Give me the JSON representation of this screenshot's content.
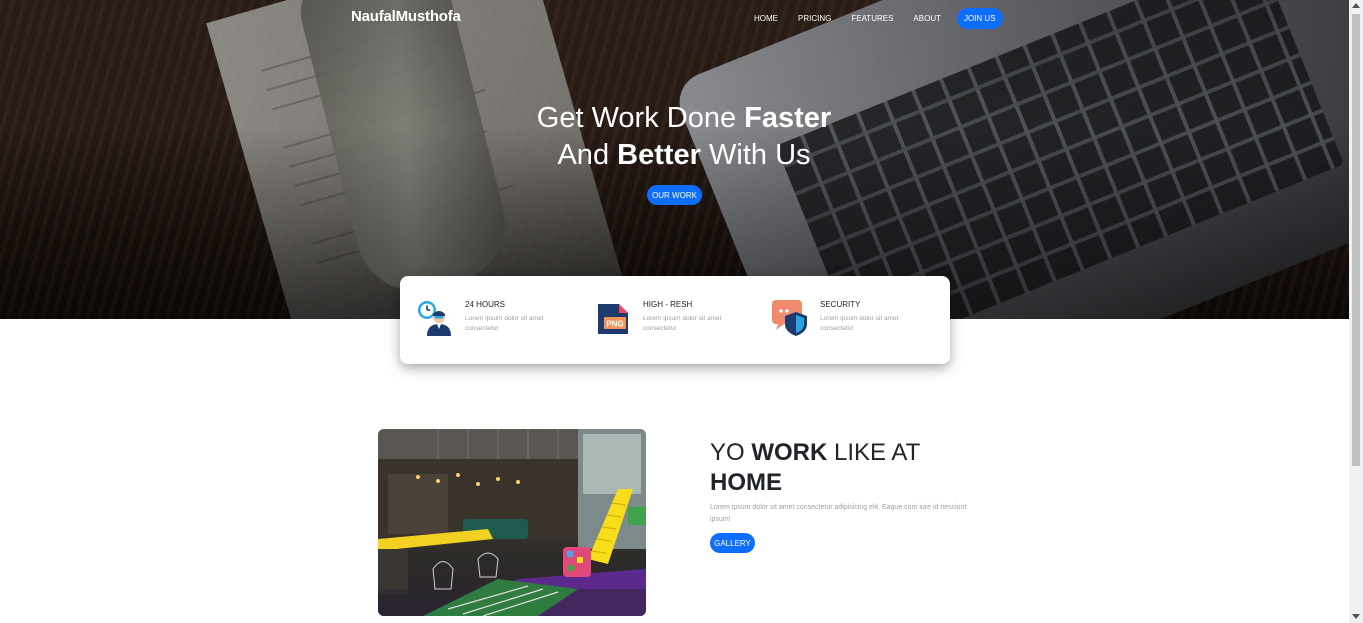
{
  "navbar": {
    "brand": "NaufalMusthofa",
    "links": [
      "HOME",
      "PRICING",
      "FEATURES",
      "ABOUT"
    ],
    "cta": "JOIN US"
  },
  "hero": {
    "line1_normal": "Get Work Done ",
    "line1_bold": "Faster",
    "line2_normal_a": "And ",
    "line2_bold": "Better",
    "line2_normal_b": " With Us",
    "button": "OUR WORK"
  },
  "features": [
    {
      "title": "24 HOURS",
      "text": "Lorem ipsum dolor sit amet consectetur",
      "icon": "clock-person-icon"
    },
    {
      "title": "HIGH - RESH",
      "text": "Lorem ipsum dolor sit amet consectetur",
      "icon": "png-file-icon",
      "badge": "PNG"
    },
    {
      "title": "SECURITY",
      "text": "Lorem ipsum dolor sit amet consectetur",
      "icon": "shield-icon"
    }
  ],
  "about": {
    "title_a": "YO ",
    "title_bold": "WORK",
    "title_b": " LIKE AT",
    "title_line2": "HOME",
    "text": "Lorem ipsum dolor sit amet consectetur adipisicing elit. Eaque cum iure id nesciunt ipsum!",
    "button": "GALLERY"
  },
  "colors": {
    "accent": "#0d6efd",
    "text": "#212529",
    "muted": "#9aa0a6"
  }
}
